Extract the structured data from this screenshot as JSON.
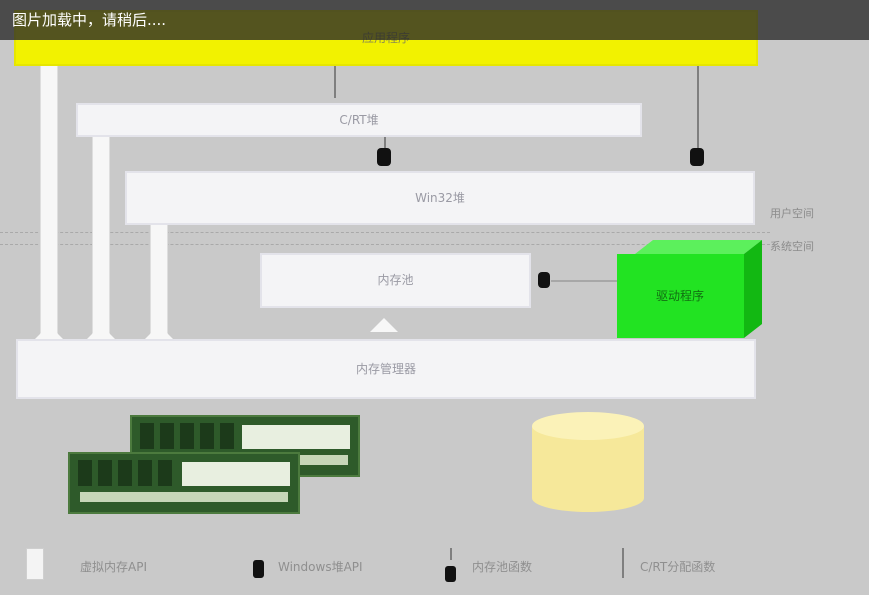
{
  "loading_text": "图片加载中，请稍后....",
  "diagram": {
    "application": "应用程序",
    "crt_heap": "C/RT堆",
    "win_heap": "Win32堆",
    "kernel": "内存池",
    "virtual_memory_manager": "内存管理器",
    "driver": "驱动程序",
    "side_labels": [
      "用户空间",
      "系统空间"
    ]
  },
  "legend": [
    {
      "icon": "white-arrow-pipe",
      "label": "虚拟内存API"
    },
    {
      "icon": "black-plug",
      "label": "Windows堆API"
    },
    {
      "icon": "kernel-call",
      "label": "内存池函数"
    },
    {
      "icon": "thin-line",
      "label": "C/RT分配函数"
    }
  ],
  "colors": {
    "application": "#f2f200",
    "driver": "#22e322",
    "disk": "#f6e89a",
    "background": "#c9c9c9"
  }
}
